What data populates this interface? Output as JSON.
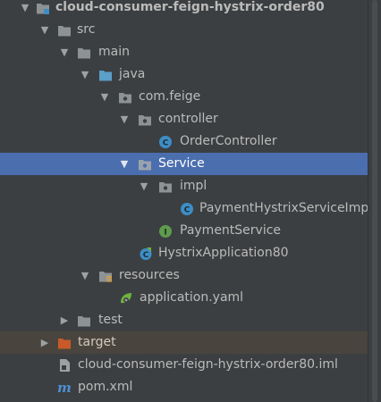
{
  "project_tree": {
    "root": {
      "label": "cloud-consumer-feign-hystrix-order80",
      "icon": "module-folder-icon"
    },
    "src": {
      "label": "src",
      "icon": "folder-icon"
    },
    "main": {
      "label": "main",
      "icon": "folder-icon"
    },
    "java": {
      "label": "java",
      "icon": "source-root-icon"
    },
    "pkg_feige": {
      "label": "com.feige",
      "icon": "package-icon"
    },
    "controller": {
      "label": "controller",
      "icon": "package-icon"
    },
    "order_controller": {
      "label": "OrderController",
      "icon": "class-icon"
    },
    "service": {
      "label": "Service",
      "icon": "package-icon",
      "selected": true
    },
    "impl": {
      "label": "impl",
      "icon": "package-icon"
    },
    "payment_impl": {
      "label": "PaymentHystrixServiceImp",
      "icon": "class-icon"
    },
    "payment_service": {
      "label": "PaymentService",
      "icon": "interface-icon"
    },
    "application": {
      "label": "HystrixApplication80",
      "icon": "spring-boot-class-icon"
    },
    "resources": {
      "label": "resources",
      "icon": "resources-folder-icon"
    },
    "yaml": {
      "label": "application.yaml",
      "icon": "spring-config-icon"
    },
    "test": {
      "label": "test",
      "icon": "folder-icon"
    },
    "target": {
      "label": "target",
      "icon": "excluded-folder-icon"
    },
    "iml": {
      "label": "cloud-consumer-feign-hystrix-order80.iml",
      "icon": "iml-file-icon"
    },
    "pom": {
      "label": "pom.xml",
      "icon": "maven-icon"
    }
  },
  "colors": {
    "background": "#3c3f41",
    "selection": "#4b6eaf",
    "excluded_row": "#49453e",
    "text": "#bbbbbb",
    "folder": "#8d9294",
    "source_root": "#5aa0c8",
    "class_icon": "#3d8ec6",
    "interface_icon": "#5e9b4f",
    "excluded_folder": "#c75a28"
  }
}
